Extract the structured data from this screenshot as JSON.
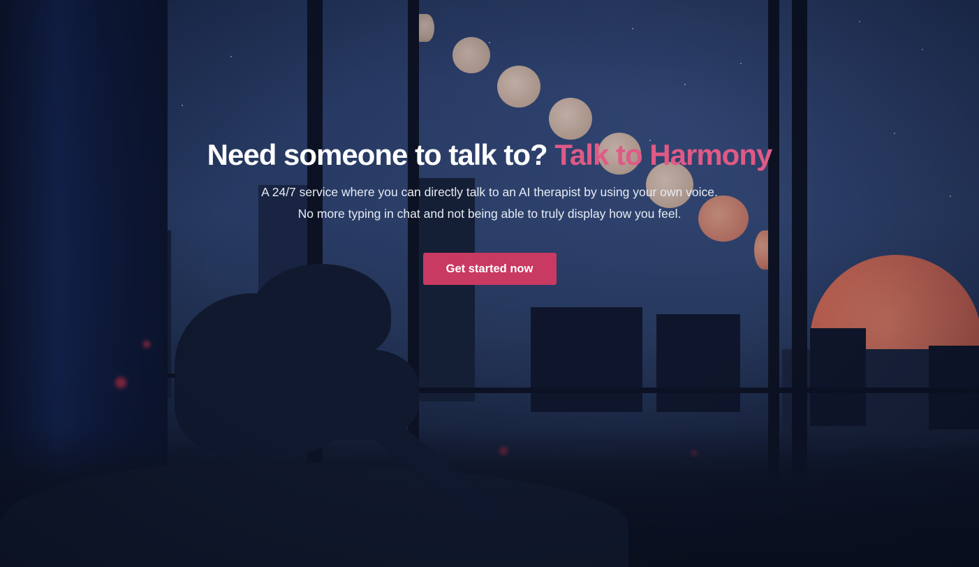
{
  "hero": {
    "headline_main": "Need someone to talk to?",
    "headline_accent": "Talk to Harmony",
    "description": "A 24/7 service where you can directly talk to an AI therapist by using your own voice. No more typing in chat and not being able to truly display how you feel.",
    "cta_label": "Get started now"
  },
  "colors": {
    "accent": "#e05a86",
    "button": "#c83a62"
  }
}
